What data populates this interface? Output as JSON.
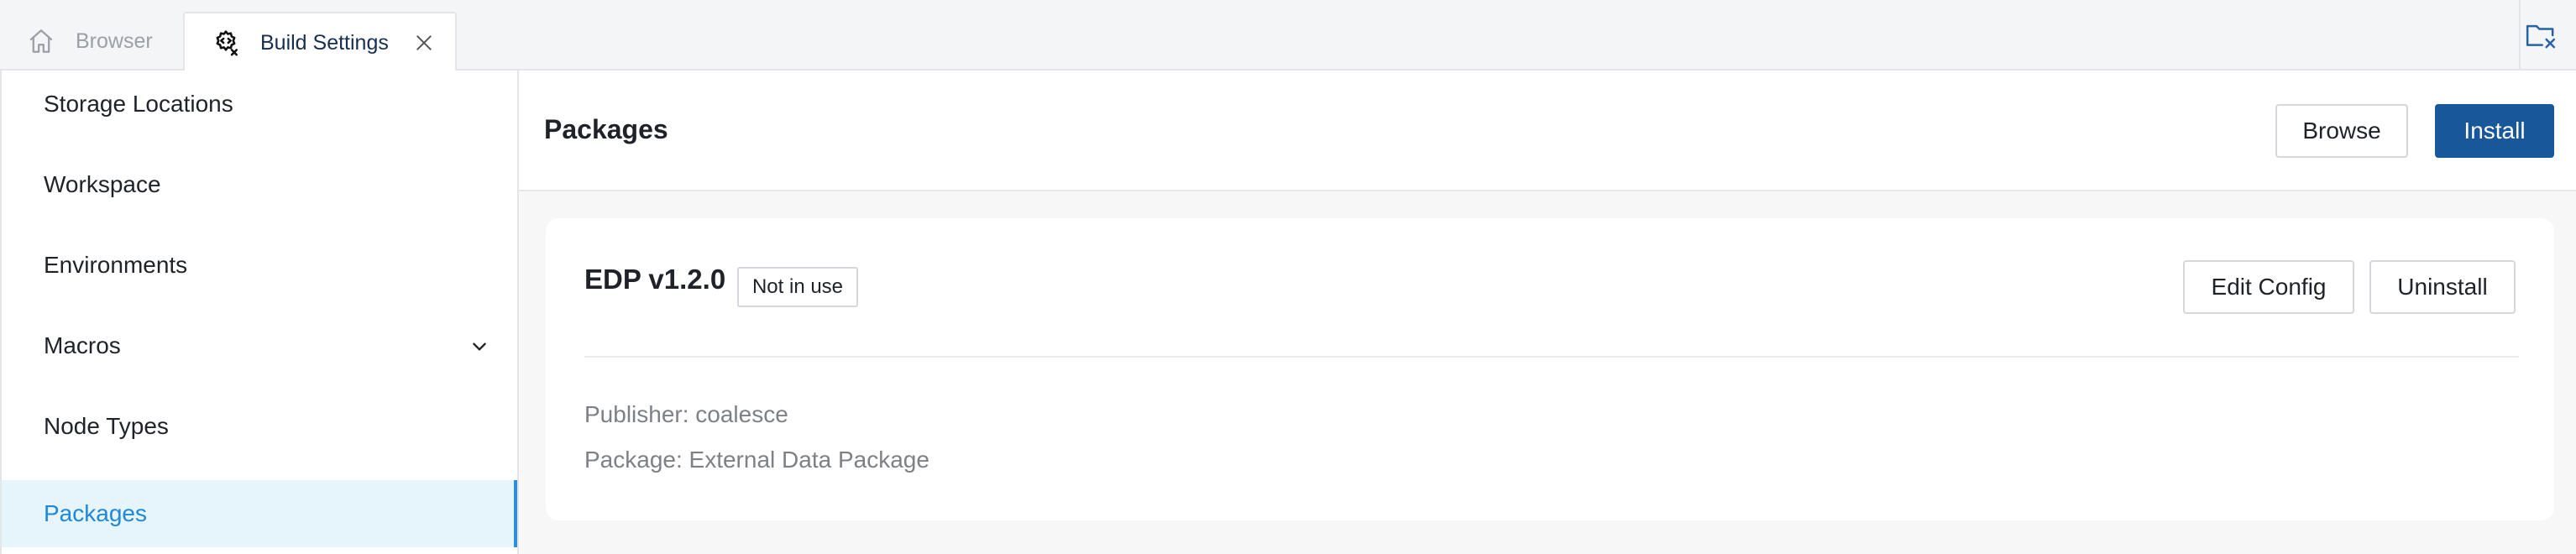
{
  "tabs": [
    {
      "label": "Browser",
      "icon": "home-icon",
      "active": false
    },
    {
      "label": "Build Settings",
      "icon": "gear-code-icon",
      "active": true,
      "closable": true
    }
  ],
  "tabbar_action_icon": "folder-close-icon",
  "sidebar": {
    "items": [
      {
        "label": "Storage Locations",
        "active": false
      },
      {
        "label": "Workspace",
        "active": false
      },
      {
        "label": "Environments",
        "active": false
      },
      {
        "label": "Macros",
        "active": false,
        "expandable": true
      },
      {
        "label": "Node Types",
        "active": false
      },
      {
        "label": "Packages",
        "active": true
      }
    ]
  },
  "main": {
    "title": "Packages",
    "browse_label": "Browse",
    "install_label": "Install"
  },
  "package": {
    "name": "EDP v1.2.0",
    "status": "Not in use",
    "edit_label": "Edit Config",
    "uninstall_label": "Uninstall",
    "publisher": "Publisher: coalesce",
    "package_line": "Package: External Data Package"
  },
  "colors": {
    "accent": "#1f88d9",
    "primary_button": "#18579a",
    "active_item_bg": "#e6f4fc",
    "muted_text": "#7d8187"
  }
}
